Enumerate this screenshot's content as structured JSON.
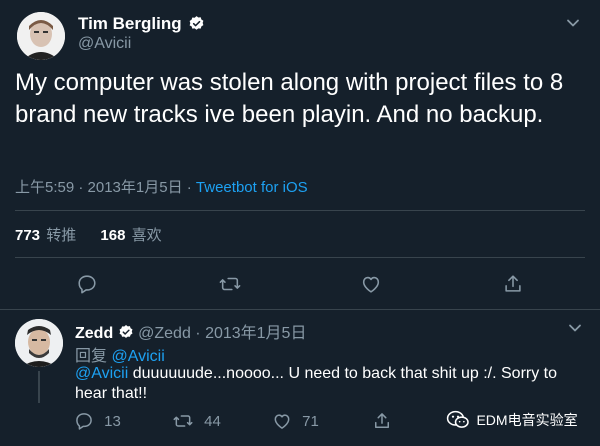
{
  "tweet": {
    "author_name": "Tim Bergling",
    "author_handle": "@Avicii",
    "text": "My computer was stolen along with project files to 8 brand new tracks ive been playin. And no backup.",
    "time_prefix": "上午5:59 · 2013年1月5日 · ",
    "source": "Tweetbot for iOS",
    "retweets_count": "773",
    "retweets_label": "转推",
    "likes_count": "168",
    "likes_label": "喜欢"
  },
  "reply": {
    "author_name": "Zedd",
    "author_handle": "@Zedd",
    "date": " · 2013年1月5日",
    "reply_prefix": "回复 ",
    "reply_to": "@Avicii",
    "mention": "@Avicii",
    "text_line1": " duuuuuude...noooo... U need to back that shit up :/. Sorry to",
    "text_line2": "hear that!!",
    "reply_count": "13",
    "retweet_count": "44",
    "like_count": "71"
  },
  "watermark": {
    "text": "EDM电音实验室"
  },
  "colors": {
    "background": "#15202b",
    "muted": "#8899a6",
    "link": "#1da1f2",
    "divider": "#38444d"
  }
}
